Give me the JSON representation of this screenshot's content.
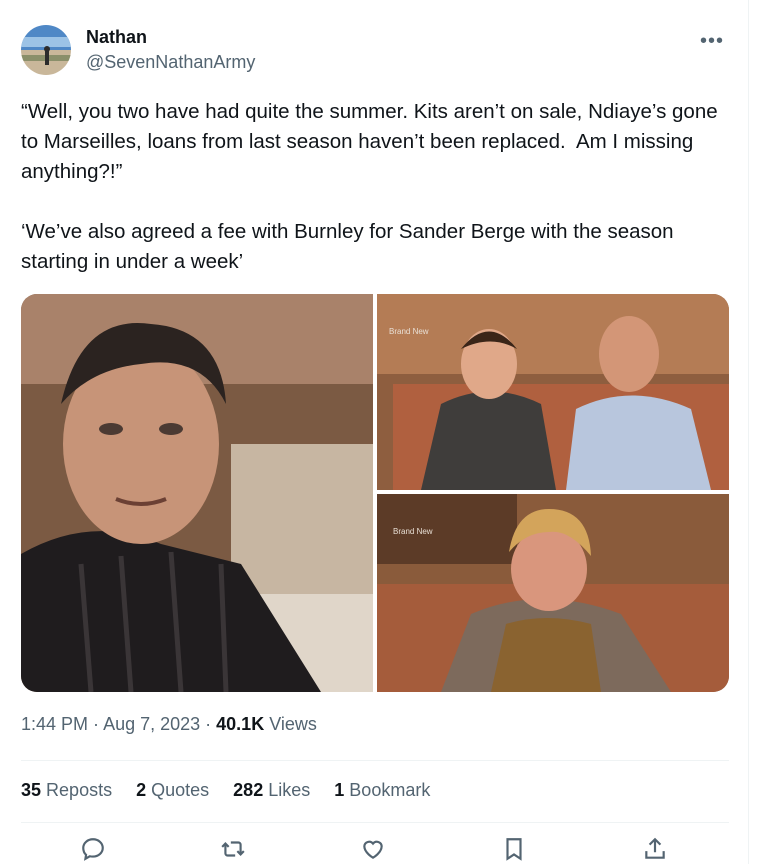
{
  "author": {
    "name": "Nathan",
    "handle": "@SevenNathanArmy"
  },
  "tweet_text": "“Well, you two have had quite the summer. Kits aren’t on sale, Ndiaye’s gone to Marseilles, loans from last season haven’t been replaced.  Am I missing anything?!”\n\n‘We’ve also agreed a fee with Burnley for Sander Berge with the season starting in under a week’",
  "media": {
    "watermark": "Brand New"
  },
  "meta": {
    "time": "1:44 PM",
    "date": "Aug 7, 2023",
    "views_count": "40.1K",
    "views_label": "Views"
  },
  "stats": [
    {
      "count": "35",
      "label": "Reposts"
    },
    {
      "count": "2",
      "label": "Quotes"
    },
    {
      "count": "282",
      "label": "Likes"
    },
    {
      "count": "1",
      "label": "Bookmark"
    }
  ],
  "icons": {
    "more": "more-icon",
    "reply": "reply-icon",
    "repost": "repost-icon",
    "like": "heart-icon",
    "bookmark": "bookmark-icon",
    "share": "share-icon"
  },
  "colors": {
    "text": "#0f1419",
    "secondary": "#536471",
    "divider": "#eff3f4"
  }
}
